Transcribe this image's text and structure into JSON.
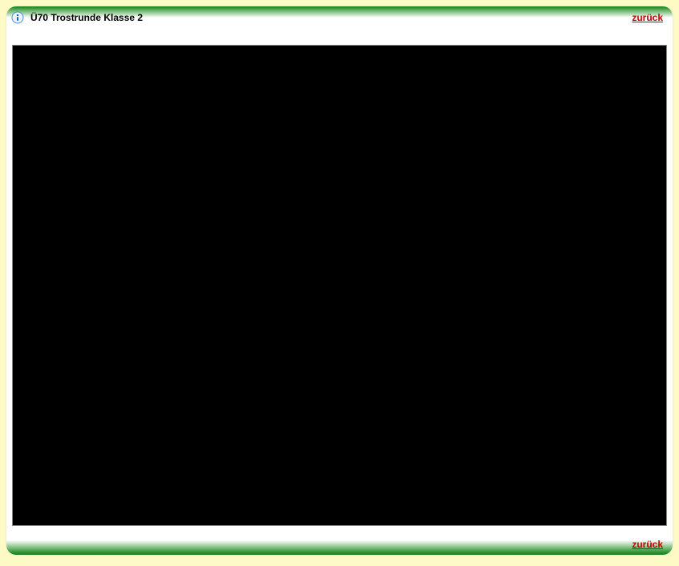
{
  "header": {
    "title": "Ü70 Trostrunde Klasse 2",
    "back_link": "zurück"
  },
  "footer": {
    "back_link": "zurück"
  }
}
